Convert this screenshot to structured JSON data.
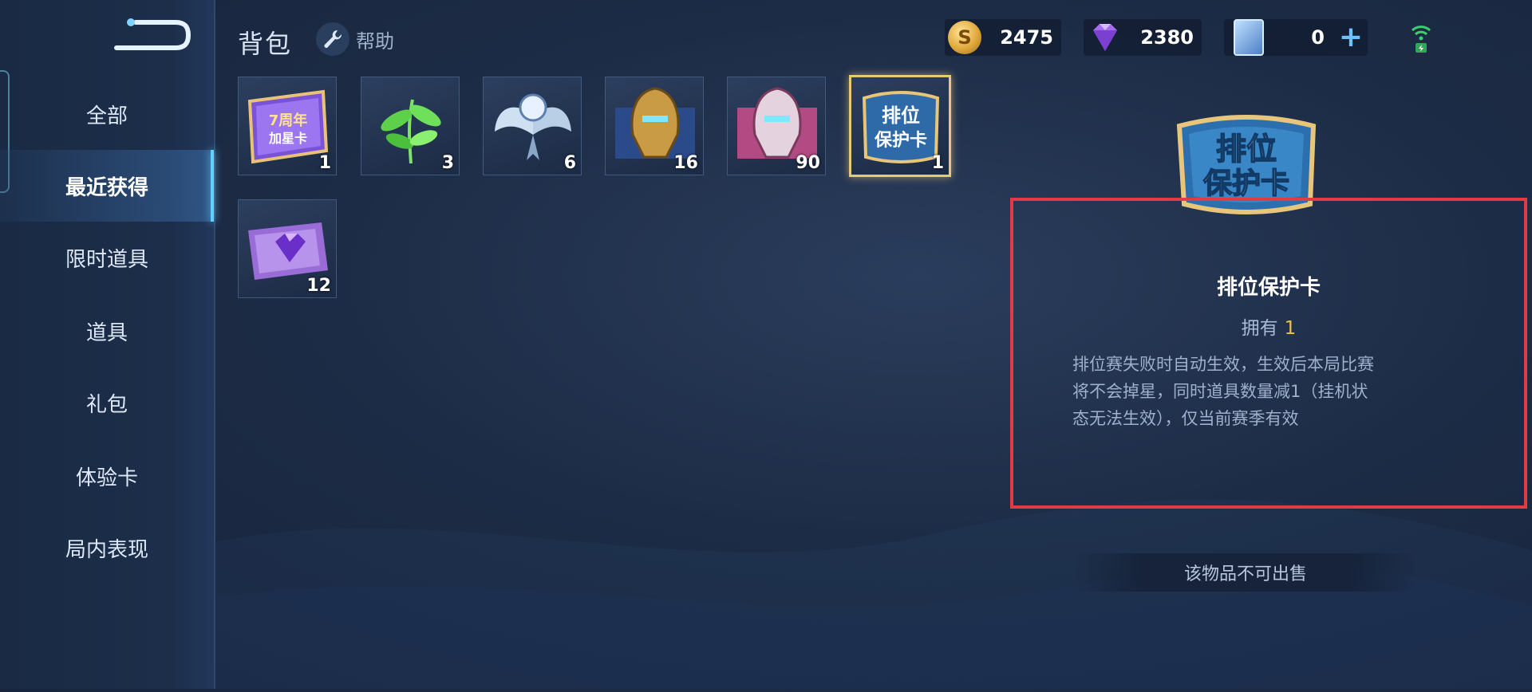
{
  "header": {
    "title": "背包",
    "help_label": "帮助"
  },
  "currencies": [
    {
      "name": "coins",
      "value": "2475",
      "icon": "coin-icon"
    },
    {
      "name": "diamonds",
      "value": "2380",
      "icon": "diamond-icon"
    },
    {
      "name": "tickets",
      "value": "0",
      "icon": "ticket-icon"
    }
  ],
  "coin_glyph": "S",
  "plus_glyph": "+",
  "sidebar": {
    "items": [
      {
        "label": "全部",
        "active": false
      },
      {
        "label": "最近获得",
        "active": true
      },
      {
        "label": "限时道具",
        "active": false
      },
      {
        "label": "道具",
        "active": false
      },
      {
        "label": "礼包",
        "active": false
      },
      {
        "label": "体验卡",
        "active": false
      },
      {
        "label": "局内表现",
        "active": false
      }
    ]
  },
  "inventory": [
    {
      "name": "7-star-card",
      "count": "1",
      "art_text": "7周年",
      "art_text2": "加星卡"
    },
    {
      "name": "green-leaf",
      "count": "3"
    },
    {
      "name": "winged-emblem",
      "count": "6"
    },
    {
      "name": "gold-helmet-fragment",
      "count": "16"
    },
    {
      "name": "pink-helmet-fragment",
      "count": "90"
    },
    {
      "name": "rank-protection-card",
      "count": "1",
      "selected": true,
      "art_text": "排位",
      "art_text2": "保护卡"
    },
    {
      "name": "purple-diamond-ticket",
      "count": "12"
    }
  ],
  "detail": {
    "art_text1": "排位",
    "art_text2": "保护卡",
    "name": "排位保护卡",
    "owned_label": "拥有",
    "owned_count": "1",
    "description_lines": [
      "排位赛失败时自动生效，生效后本局比赛",
      "将不会掉星，同时道具数量减1（挂机状",
      "态无法生效），仅当前赛季有效"
    ],
    "sell_note": "该物品不可出售"
  },
  "colors": {
    "accent": "#5fd0ff",
    "highlight_box": "#e03c44",
    "gold": "#f0c04a"
  }
}
